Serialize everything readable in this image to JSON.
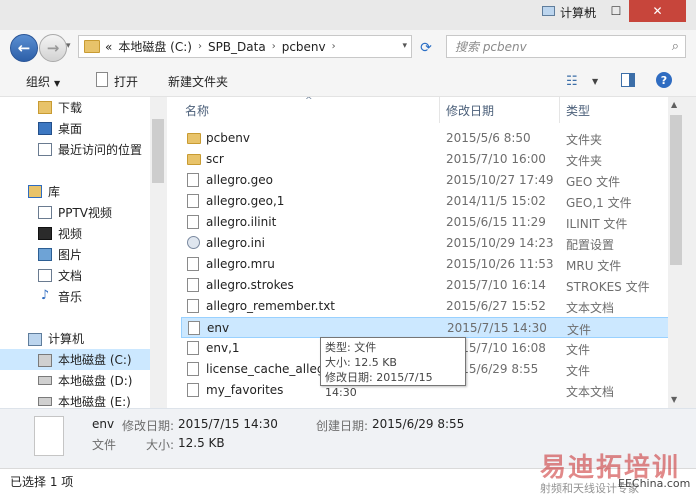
{
  "window": {
    "min": "—",
    "max": "☐",
    "close": "✕"
  },
  "address": {
    "history": "«",
    "crumbs": [
      "本地磁盘 (C:)",
      "SPB_Data",
      "pcbenv"
    ],
    "separator": "›",
    "dropdown": "▾",
    "search_placeholder": "搜索 pcbenv"
  },
  "toolbar": {
    "organize": "组织",
    "open": "打开",
    "new_folder": "新建文件夹"
  },
  "nav": {
    "favorites": [
      "下载",
      "桌面",
      "最近访问的位置"
    ],
    "libraries_label": "库",
    "libraries": [
      "PPTV视频",
      "视频",
      "图片",
      "文档",
      "音乐"
    ],
    "computer_label": "计算机",
    "drives": [
      "本地磁盘 (C:)",
      "本地磁盘 (D:)",
      "本地磁盘 (E:)"
    ]
  },
  "columns": {
    "name": "名称",
    "date": "修改日期",
    "type": "类型"
  },
  "files": [
    {
      "name": "pcbenv",
      "date": "2015/5/6 8:50",
      "type": "文件夹",
      "kind": "folder"
    },
    {
      "name": "scr",
      "date": "2015/7/10 16:00",
      "type": "文件夹",
      "kind": "folder"
    },
    {
      "name": "allegro.geo",
      "date": "2015/10/27 17:49",
      "type": "GEO 文件",
      "kind": "file"
    },
    {
      "name": "allegro.geo,1",
      "date": "2014/11/5 15:02",
      "type": "GEO,1 文件",
      "kind": "file"
    },
    {
      "name": "allegro.ilinit",
      "date": "2015/6/15 11:29",
      "type": "ILINIT 文件",
      "kind": "file"
    },
    {
      "name": "allegro.ini",
      "date": "2015/10/29 14:23",
      "type": "配置设置",
      "kind": "config"
    },
    {
      "name": "allegro.mru",
      "date": "2015/10/26 11:53",
      "type": "MRU 文件",
      "kind": "file"
    },
    {
      "name": "allegro.strokes",
      "date": "2015/7/10 16:14",
      "type": "STROKES 文件",
      "kind": "file"
    },
    {
      "name": "allegro_remember.txt",
      "date": "2015/6/27 15:52",
      "type": "文本文档",
      "kind": "file"
    },
    {
      "name": "env",
      "date": "2015/7/15 14:30",
      "type": "文件",
      "kind": "file",
      "selected": true
    },
    {
      "name": "env,1",
      "date": "2015/7/10 16:08",
      "type": "文件",
      "kind": "file"
    },
    {
      "name": "license_cache_allegro",
      "date": "2015/6/29 8:55",
      "type": "文件",
      "kind": "file"
    },
    {
      "name": "my_favorites",
      "date": "",
      "type": "文本文档",
      "kind": "file"
    }
  ],
  "tooltip": {
    "line1": "类型: 文件",
    "line2": "大小: 12.5 KB",
    "line3": "修改日期: 2015/7/15 14:30"
  },
  "details": {
    "name": "env",
    "modified_label": "修改日期:",
    "modified": "2015/7/15 14:30",
    "created_label": "创建日期:",
    "created": "2015/6/29 8:55",
    "type": "文件",
    "size_label": "大小:",
    "size": "12.5 KB"
  },
  "status": {
    "selected": "已选择 1 项",
    "computer": "计算机"
  },
  "watermark": {
    "brand": "易迪拓培训",
    "slogan": "射频和天线设计专家",
    "site": "EEChina.com"
  }
}
